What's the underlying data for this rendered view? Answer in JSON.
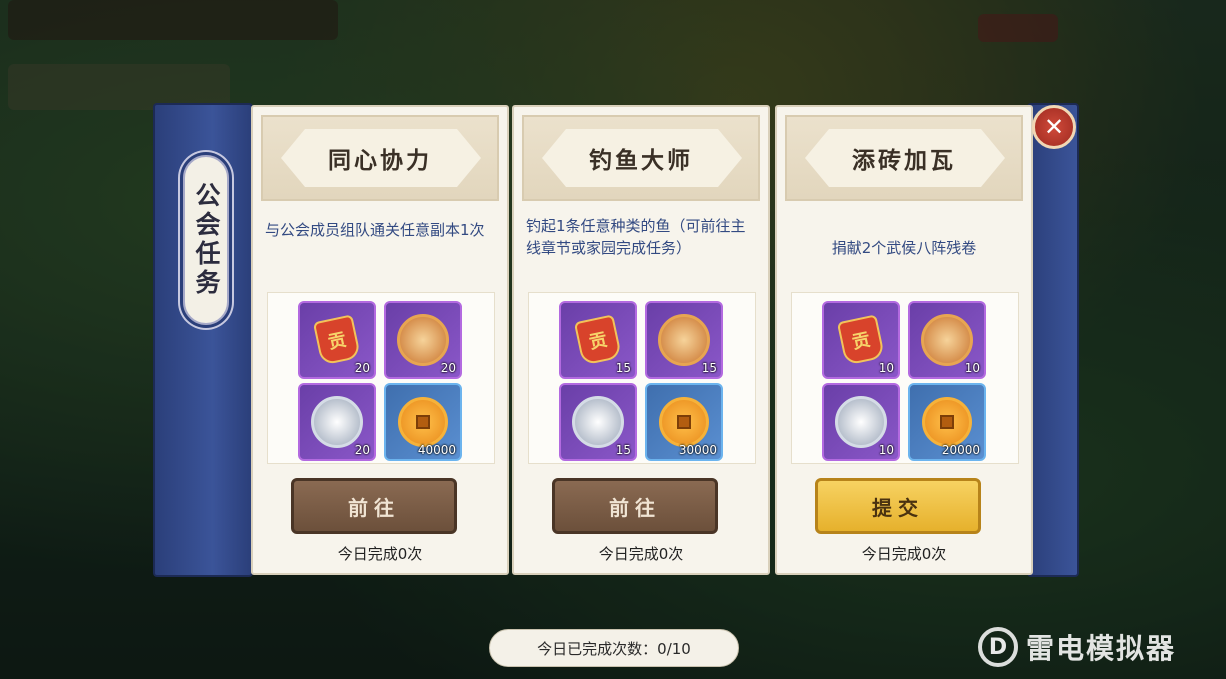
{
  "panel_title": "公会任务",
  "cards": [
    {
      "name": "同心协力",
      "description": "与公会成员组队通关任意副本1次",
      "rewards": [
        {
          "icon": "contribution-token-icon",
          "qty": "20"
        },
        {
          "icon": "gold-dragon-medal-icon",
          "qty": "20"
        },
        {
          "icon": "silver-dragon-medal-icon",
          "qty": "20"
        },
        {
          "icon": "copper-coin-icon",
          "qty": "40000"
        }
      ],
      "button": "前往",
      "completed_today": "今日完成0次"
    },
    {
      "name": "钓鱼大师",
      "description": "钓起1条任意种类的鱼（可前往主线章节或家园完成任务）",
      "rewards": [
        {
          "icon": "contribution-token-icon",
          "qty": "15"
        },
        {
          "icon": "gold-dragon-medal-icon",
          "qty": "15"
        },
        {
          "icon": "silver-dragon-medal-icon",
          "qty": "15"
        },
        {
          "icon": "copper-coin-icon",
          "qty": "30000"
        }
      ],
      "button": "前往",
      "completed_today": "今日完成0次"
    },
    {
      "name": "添砖加瓦",
      "description": "捐献2个武侯八阵残卷",
      "rewards": [
        {
          "icon": "contribution-token-icon",
          "qty": "10"
        },
        {
          "icon": "gold-dragon-medal-icon",
          "qty": "10"
        },
        {
          "icon": "silver-dragon-medal-icon",
          "qty": "10"
        },
        {
          "icon": "copper-coin-icon",
          "qty": "20000"
        }
      ],
      "button": "提交",
      "completed_today": "今日完成0次"
    }
  ],
  "daily_count": "今日已完成次数：0/10",
  "reward_glyph": "贡",
  "watermark_icon": "D",
  "watermark": "雷电模拟器",
  "colors": {
    "frame_blue": "#3b5499",
    "button_brown": "#6c503b",
    "button_gold": "#e6b12c",
    "close_red": "#c23a2e"
  }
}
